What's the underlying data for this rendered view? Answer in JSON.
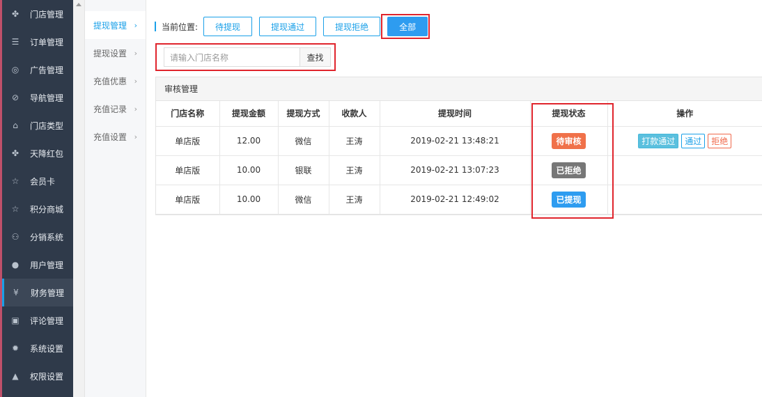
{
  "sidebar": {
    "items": [
      {
        "label": "门店管理",
        "icon": "cubes-icon"
      },
      {
        "label": "订单管理",
        "icon": "list-icon"
      },
      {
        "label": "广告管理",
        "icon": "lifebuoy-icon"
      },
      {
        "label": "导航管理",
        "icon": "compass-icon"
      },
      {
        "label": "门店类型",
        "icon": "bank-icon"
      },
      {
        "label": "天降红包",
        "icon": "cubes-icon"
      },
      {
        "label": "会员卡",
        "icon": "star-icon"
      },
      {
        "label": "积分商城",
        "icon": "star-icon"
      },
      {
        "label": "分销系统",
        "icon": "users-icon"
      },
      {
        "label": "用户管理",
        "icon": "user-icon"
      },
      {
        "label": "财务管理",
        "icon": "yen-icon",
        "active": true
      },
      {
        "label": "评论管理",
        "icon": "money-icon"
      },
      {
        "label": "系统设置",
        "icon": "gear-icon"
      },
      {
        "label": "权限设置",
        "icon": "lock-icon"
      }
    ]
  },
  "submenu": {
    "items": [
      {
        "label": "提现管理",
        "active": true
      },
      {
        "label": "提现设置"
      },
      {
        "label": "充值优惠"
      },
      {
        "label": "充值记录"
      },
      {
        "label": "充值设置"
      }
    ]
  },
  "breadcrumb": {
    "location_label": "当前位置:",
    "tabs": [
      "待提现",
      "提现通过",
      "提现拒绝",
      "全部"
    ],
    "active_tab": "全部"
  },
  "search": {
    "placeholder": "请输入门店名称",
    "button": "查找"
  },
  "panel": {
    "title": "审核管理",
    "columns": [
      "门店名称",
      "提现金额",
      "提现方式",
      "收款人",
      "提现时间",
      "提现状态",
      "操作"
    ],
    "rows": [
      {
        "store": "单店版",
        "amount": "12.00",
        "method": "微信",
        "payee": "王涛",
        "time": "2019-02-21 13:48:21",
        "status": "待审核",
        "status_color": "#f0714a",
        "actions": [
          "打款通过",
          "通过",
          "拒绝"
        ]
      },
      {
        "store": "单店版",
        "amount": "10.00",
        "method": "银联",
        "payee": "王涛",
        "time": "2019-02-21 13:07:23",
        "status": "已拒绝",
        "status_color": "#777777",
        "actions": []
      },
      {
        "store": "单店版",
        "amount": "10.00",
        "method": "微信",
        "payee": "王涛",
        "time": "2019-02-21 12:49:02",
        "status": "已提现",
        "status_color": "#2e9cf0",
        "actions": []
      }
    ]
  },
  "colors": {
    "accent": "#1aa0e8",
    "sidebar_bg": "#2f3a4a",
    "highlight": "#e0242c"
  }
}
